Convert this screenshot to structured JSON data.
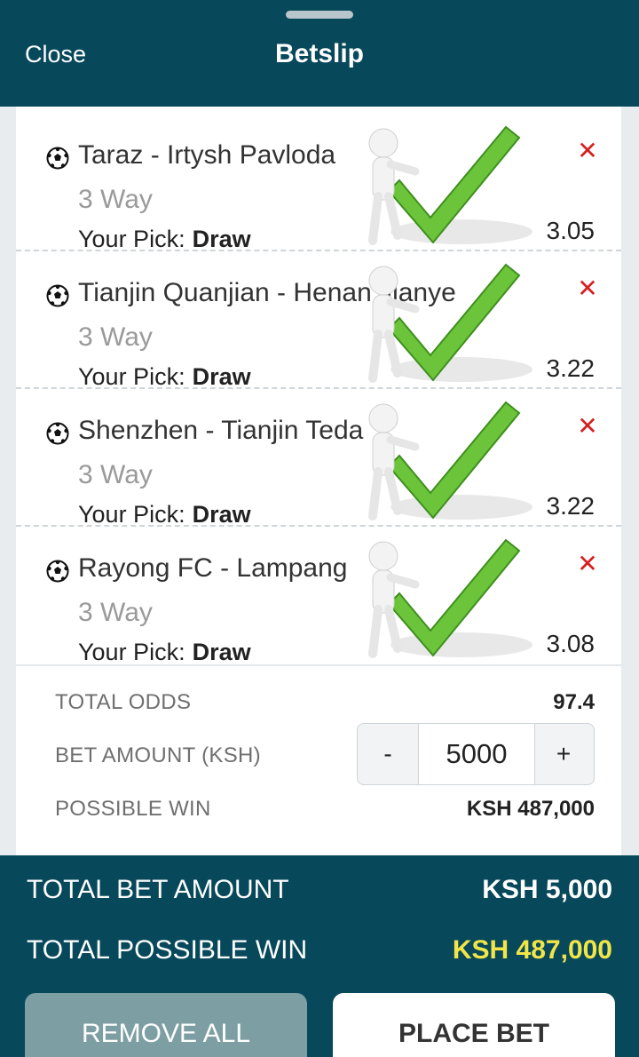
{
  "header": {
    "close_label": "Close",
    "title": "Betslip"
  },
  "bets": [
    {
      "match": "Taraz - Irtysh Pavloda",
      "market": "3 Way",
      "pick_label": "Your Pick:",
      "pick": "Draw",
      "odds": "3.05"
    },
    {
      "match": "Tianjin Quanjian - Henan Jianye",
      "market": "3 Way",
      "pick_label": "Your Pick:",
      "pick": "Draw",
      "odds": "3.22"
    },
    {
      "match": "Shenzhen - Tianjin Teda",
      "market": "3 Way",
      "pick_label": "Your Pick:",
      "pick": "Draw",
      "odds": "3.22"
    },
    {
      "match": "Rayong FC - Lampang",
      "market": "3 Way",
      "pick_label": "Your Pick:",
      "pick": "Draw",
      "odds": "3.08"
    }
  ],
  "summary": {
    "total_odds_label": "TOTAL ODDS",
    "total_odds": "97.4",
    "bet_amount_label": "BET AMOUNT (KSH)",
    "bet_amount": "5000",
    "minus_label": "-",
    "plus_label": "+",
    "possible_win_label": "POSSIBLE WIN",
    "possible_win": "KSH 487,000"
  },
  "footer": {
    "total_bet_label": "TOTAL BET AMOUNT",
    "total_bet": "KSH 5,000",
    "total_win_label": "TOTAL POSSIBLE WIN",
    "total_win": "KSH 487,000",
    "remove_all_label": "REMOVE ALL",
    "place_bet_label": "PLACE BET"
  },
  "colors": {
    "header_bg": "#07485b",
    "remove_x": "#d71f1f",
    "win_highlight": "#f1e547",
    "check_green": "#6cc43a"
  },
  "icons": {
    "match": "soccer-ball-icon",
    "remove": "close-x-icon",
    "sticker": "checkmark-figure-icon"
  }
}
